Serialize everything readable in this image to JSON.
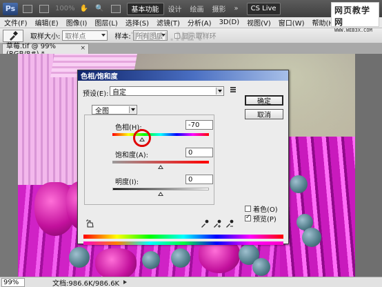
{
  "app": {
    "logo": "Ps",
    "zoom_readout": "100%",
    "workspaces": [
      "基本功能",
      "设计",
      "绘画",
      "摄影"
    ],
    "more": "»",
    "cs_live": "CS Live",
    "watermark_title": "网页教学网",
    "watermark_url": "WWW.WEB3X.COM",
    "overlay_watermark": "TILVI.NET"
  },
  "menu": [
    "文件(F)",
    "编辑(E)",
    "图像(I)",
    "图层(L)",
    "选择(S)",
    "滤镜(T)",
    "分析(A)",
    "3D(D)",
    "视图(V)",
    "窗口(W)",
    "帮助(H)"
  ],
  "options": {
    "sample_size_label": "取样大小:",
    "sample_size_value": "取样点",
    "sample_label": "样本:",
    "sample_value": "所有图层",
    "show_ring": "显示取样环"
  },
  "document": {
    "tab_title": "草莓.tif @ 99%(RGB/8#) *",
    "close": "×"
  },
  "status": {
    "zoom": "99%",
    "doc_info": "文档:986.6K/986.6K"
  },
  "dialog": {
    "title": "色相/饱和度",
    "preset_label": "预设(E):",
    "preset_value": "自定",
    "ok": "确定",
    "cancel": "取消",
    "channel": "全图",
    "hue_label": "色相(H):",
    "hue_value": "-70",
    "saturation_label": "饱和度(A):",
    "saturation_value": "0",
    "lightness_label": "明度(I):",
    "lightness_value": "0",
    "colorize_label": "着色(O)",
    "colorize_checked": false,
    "preview_label": "预览(P)",
    "preview_checked": true,
    "hue_slider_fraction": 0.305,
    "saturation_slider_fraction": 0.5,
    "lightness_slider_fraction": 0.5
  }
}
